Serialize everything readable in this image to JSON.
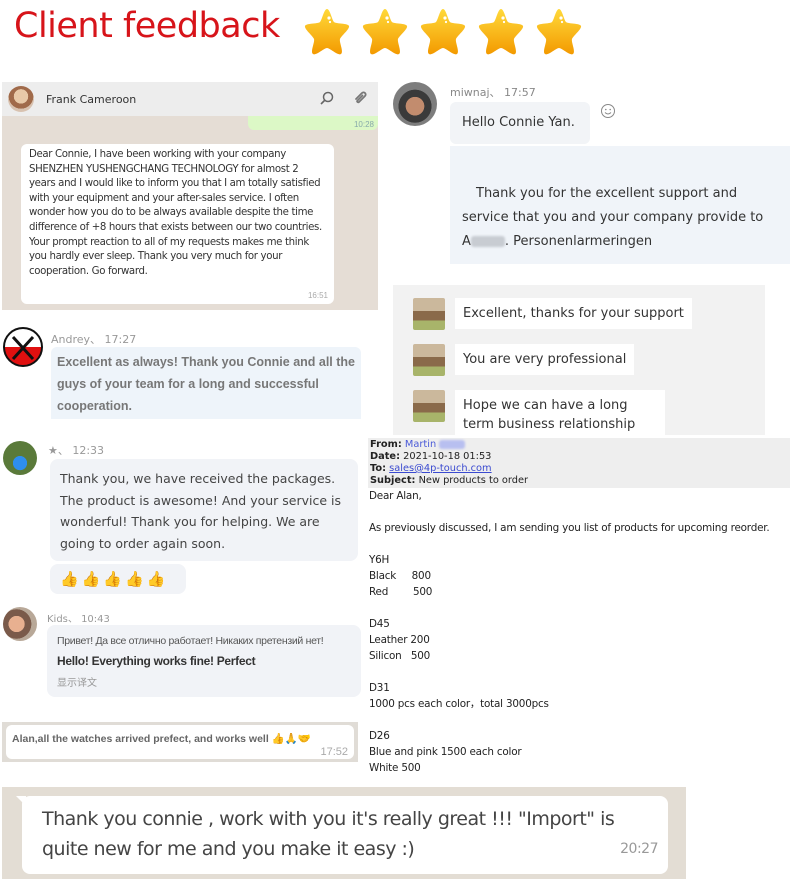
{
  "header": {
    "title": "Client feedback",
    "rating": 5,
    "star_color": "#f7b500",
    "title_color": "#d7141a"
  },
  "frank": {
    "contact_name": "Frank Cameroon",
    "sent_time": "10:28",
    "message": "Dear Connie, I have been working with your company SHENZHEN YUSHENGCHANG TECHNOLOGY for almost 2 years and I would like to inform you that I am totally satisfied with your equipment and your after-sales service. I often wonder how you do to be always available despite the time difference of +8 hours that exists between our two countries.  Your prompt reaction to all of my requests makes me think you hardly ever sleep.  Thank you very much for your cooperation.  Go forward.",
    "time": "16:51"
  },
  "miwnaj": {
    "meta": "miwnaj、 17:57",
    "greeting": "Hello Connie Yan.",
    "line1": "Thank you for the excellent support and",
    "line2": "service that you and your company provide to",
    "line3_prefix": "A",
    "line3_suffix": ". Personenlarmeringen"
  },
  "group": {
    "messages": [
      "Excellent, thanks for your support",
      "You are very professional",
      "Hope we can have a long term business relationship"
    ]
  },
  "andrey": {
    "meta": "Andrey、 17:27",
    "message": "Excellent as always! Thank you Connie and all the guys of your team for a long and successful cooperation."
  },
  "star_user": {
    "meta": "★、 12:33",
    "message": "Thank you, we have received the packages. The product is awesome! And your service is wonderful! Thank you for helping. We are going to order again soon.",
    "emoji": "👍👍👍👍👍"
  },
  "kids": {
    "meta": "Kids、 10:43",
    "russian": "Привет! Да все отлично работает! Никаких претензий нет!",
    "english": "Hello! Everything works fine! Perfect",
    "translate_label": "显示译文"
  },
  "alan_watches": {
    "message": "Alan,all the watches arrived prefect, and works well",
    "emoji": "👍🙏🤝",
    "time": "17:52"
  },
  "email": {
    "from_label": "From:",
    "from_value": "Martin",
    "date_label": "Date:",
    "date_value": "2021-10-18 01:53",
    "to_label": "To:",
    "to_value": "sales@4p-touch.com",
    "subject_label": "Subject:",
    "subject_value": "New products to order",
    "greeting": "Dear Alan,",
    "intro": "As previously discussed, I am sending you list of products for upcoming reorder.",
    "products": [
      {
        "model": "Y6H",
        "lines": [
          "Black     800",
          "Red        500"
        ]
      },
      {
        "model": "D45",
        "lines": [
          "Leather 200",
          "Silicon   500"
        ]
      },
      {
        "model": "D31",
        "lines": [
          "1000 pcs each color，total 3000pcs"
        ]
      },
      {
        "model": "D26",
        "lines": [
          "Blue and pink 1500 each color",
          "White 500"
        ]
      }
    ]
  },
  "bottom": {
    "message_line1": "Thank you connie , work with you it's really great !!! \"Import\" is",
    "message_line2": "quite new for me and you make it easy :)",
    "time": "20:27"
  }
}
